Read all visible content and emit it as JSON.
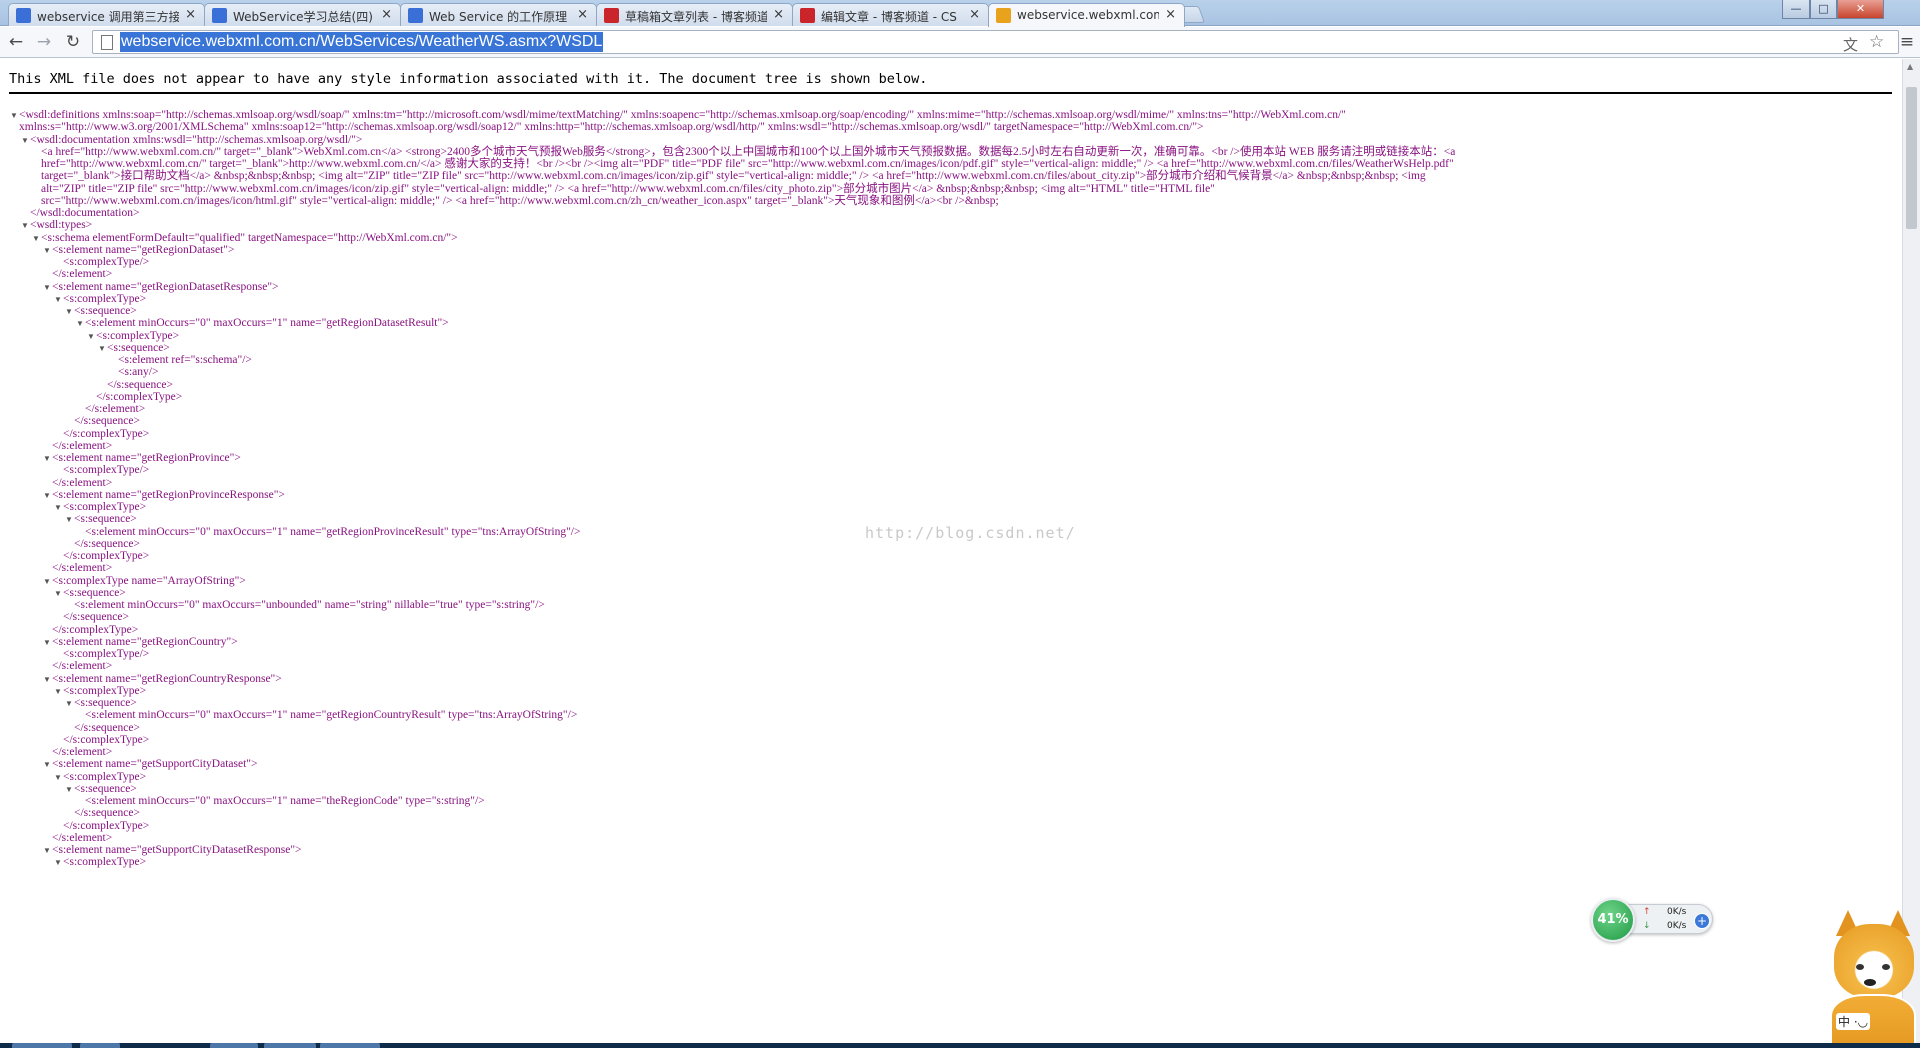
{
  "tabs": [
    {
      "title": "webservice 调用第三方接",
      "favicon_color": "#3a6fd8"
    },
    {
      "title": "WebService学习总结(四)",
      "favicon_color": "#3a6fd8"
    },
    {
      "title": "Web Service 的工作原理",
      "favicon_color": "#3a6fd8"
    },
    {
      "title": "草稿箱文章列表 - 博客频道",
      "favicon_color": "#c9252b"
    },
    {
      "title": "编辑文章 - 博客频道 - CS",
      "favicon_color": "#c9252b"
    },
    {
      "title": "webservice.webxml.com",
      "favicon_color": "#e8a21b"
    }
  ],
  "tab_close_glyph": "×",
  "window_controls": {
    "minimize": "—",
    "maximize": "□",
    "close": "✕"
  },
  "toolbar": {
    "back": "←",
    "forward": "→",
    "reload": "↻",
    "url": "webservice.webxml.com.cn/WebServices/WeatherWS.asmx?WSDL",
    "translate": "文",
    "star": "☆",
    "menu": "≡"
  },
  "notice": "This XML file does not appear to have any style information associated with it. The document tree is shown below.",
  "xml_lines": [
    {
      "i": 0,
      "t": "▼",
      "h": "<wsdl:definitions xmlns:soap=\"http://schemas.xmlsoap.org/wsdl/soap/\" xmlns:tm=\"http://microsoft.com/wsdl/mime/textMatching/\" xmlns:soapenc=\"http://schemas.xmlsoap.org/soap/encoding/\" xmlns:mime=\"http://schemas.xmlsoap.org/wsdl/mime/\" xmlns:tns=\"http://WebXml.com.cn/\""
    },
    {
      "i": 0,
      "t": "",
      "h": "xmlns:s=\"http://www.w3.org/2001/XMLSchema\" xmlns:soap12=\"http://schemas.xmlsoap.org/wsdl/soap12/\" xmlns:http=\"http://schemas.xmlsoap.org/wsdl/http/\" xmlns:wsdl=\"http://schemas.xmlsoap.org/wsdl/\" targetNamespace=\"http://WebXml.com.cn/\">"
    },
    {
      "i": 1,
      "t": "▼",
      "h": "<wsdl:documentation xmlns:wsdl=\"http://schemas.xmlsoap.org/wsdl/\">"
    },
    {
      "i": 2,
      "t": "",
      "h": "<a href=\"http://www.webxml.com.cn/\" target=\"_blank\">WebXml.com.cn</a> <strong>2400多个城市天气预报Web服务</strong>，包含2300个以上中国城市和100个以上国外城市天气预报数据。数据每2.5小时左右自动更新一次，准确可靠。<br />使用本站 WEB 服务请注明或链接本站：<a"
    },
    {
      "i": 2,
      "t": "",
      "h": "href=\"http://www.webxml.com.cn/\" target=\"_blank\">http://www.webxml.com.cn/</a> 感谢大家的支持！<br /><br /><img alt=\"PDF\" title=\"PDF file\" src=\"http://www.webxml.com.cn/images/icon/pdf.gif\" style=\"vertical-align: middle;\" /> <a href=\"http://www.webxml.com.cn/files/WeatherWsHelp.pdf\""
    },
    {
      "i": 2,
      "t": "",
      "h": "target=\"_blank\">接口帮助文档</a> &nbsp;&nbsp;&nbsp; <img alt=\"ZIP\" title=\"ZIP file\" src=\"http://www.webxml.com.cn/images/icon/zip.gif\" style=\"vertical-align: middle;\" /> <a href=\"http://www.webxml.com.cn/files/about_city.zip\">部分城市介绍和气候背景</a> &nbsp;&nbsp;&nbsp; <img"
    },
    {
      "i": 2,
      "t": "",
      "h": "alt=\"ZIP\" title=\"ZIP file\" src=\"http://www.webxml.com.cn/images/icon/zip.gif\" style=\"vertical-align: middle;\" /> <a href=\"http://www.webxml.com.cn/files/city_photo.zip\">部分城市图片</a> &nbsp;&nbsp;&nbsp; <img alt=\"HTML\" title=\"HTML file\""
    },
    {
      "i": 2,
      "t": "",
      "h": "src=\"http://www.webxml.com.cn/images/icon/html.gif\" style=\"vertical-align: middle;\" /> <a href=\"http://www.webxml.com.cn/zh_cn/weather_icon.aspx\" target=\"_blank\">天气现象和图例</a><br />&nbsp;"
    },
    {
      "i": 1,
      "t": "",
      "h": "</wsdl:documentation>"
    },
    {
      "i": 1,
      "t": "▼",
      "h": "<wsdl:types>"
    },
    {
      "i": 2,
      "t": "▼",
      "h": "<s:schema elementFormDefault=\"qualified\" targetNamespace=\"http://WebXml.com.cn/\">"
    },
    {
      "i": 3,
      "t": "▼",
      "h": "<s:element name=\"getRegionDataset\">"
    },
    {
      "i": 4,
      "t": "",
      "h": "<s:complexType/>"
    },
    {
      "i": 3,
      "t": "",
      "h": "</s:element>"
    },
    {
      "i": 3,
      "t": "▼",
      "h": "<s:element name=\"getRegionDatasetResponse\">"
    },
    {
      "i": 4,
      "t": "▼",
      "h": "<s:complexType>"
    },
    {
      "i": 5,
      "t": "▼",
      "h": "<s:sequence>"
    },
    {
      "i": 6,
      "t": "▼",
      "h": "<s:element minOccurs=\"0\" maxOccurs=\"1\" name=\"getRegionDatasetResult\">"
    },
    {
      "i": 7,
      "t": "▼",
      "h": "<s:complexType>"
    },
    {
      "i": 8,
      "t": "▼",
      "h": "<s:sequence>"
    },
    {
      "i": 9,
      "t": "",
      "h": "<s:element ref=\"s:schema\"/>"
    },
    {
      "i": 9,
      "t": "",
      "h": "<s:any/>"
    },
    {
      "i": 8,
      "t": "",
      "h": "</s:sequence>"
    },
    {
      "i": 7,
      "t": "",
      "h": "</s:complexType>"
    },
    {
      "i": 6,
      "t": "",
      "h": "</s:element>"
    },
    {
      "i": 5,
      "t": "",
      "h": "</s:sequence>"
    },
    {
      "i": 4,
      "t": "",
      "h": "</s:complexType>"
    },
    {
      "i": 3,
      "t": "",
      "h": "</s:element>"
    },
    {
      "i": 3,
      "t": "▼",
      "h": "<s:element name=\"getRegionProvince\">"
    },
    {
      "i": 4,
      "t": "",
      "h": "<s:complexType/>"
    },
    {
      "i": 3,
      "t": "",
      "h": "</s:element>"
    },
    {
      "i": 3,
      "t": "▼",
      "h": "<s:element name=\"getRegionProvinceResponse\">"
    },
    {
      "i": 4,
      "t": "▼",
      "h": "<s:complexType>"
    },
    {
      "i": 5,
      "t": "▼",
      "h": "<s:sequence>"
    },
    {
      "i": 6,
      "t": "",
      "h": "<s:element minOccurs=\"0\" maxOccurs=\"1\" name=\"getRegionProvinceResult\" type=\"tns:ArrayOfString\"/>"
    },
    {
      "i": 5,
      "t": "",
      "h": "</s:sequence>"
    },
    {
      "i": 4,
      "t": "",
      "h": "</s:complexType>"
    },
    {
      "i": 3,
      "t": "",
      "h": "</s:element>"
    },
    {
      "i": 3,
      "t": "▼",
      "h": "<s:complexType name=\"ArrayOfString\">"
    },
    {
      "i": 4,
      "t": "▼",
      "h": "<s:sequence>"
    },
    {
      "i": 5,
      "t": "",
      "h": "<s:element minOccurs=\"0\" maxOccurs=\"unbounded\" name=\"string\" nillable=\"true\" type=\"s:string\"/>"
    },
    {
      "i": 4,
      "t": "",
      "h": "</s:sequence>"
    },
    {
      "i": 3,
      "t": "",
      "h": "</s:complexType>"
    },
    {
      "i": 3,
      "t": "▼",
      "h": "<s:element name=\"getRegionCountry\">"
    },
    {
      "i": 4,
      "t": "",
      "h": "<s:complexType/>"
    },
    {
      "i": 3,
      "t": "",
      "h": "</s:element>"
    },
    {
      "i": 3,
      "t": "▼",
      "h": "<s:element name=\"getRegionCountryResponse\">"
    },
    {
      "i": 4,
      "t": "▼",
      "h": "<s:complexType>"
    },
    {
      "i": 5,
      "t": "▼",
      "h": "<s:sequence>"
    },
    {
      "i": 6,
      "t": "",
      "h": "<s:element minOccurs=\"0\" maxOccurs=\"1\" name=\"getRegionCountryResult\" type=\"tns:ArrayOfString\"/>"
    },
    {
      "i": 5,
      "t": "",
      "h": "</s:sequence>"
    },
    {
      "i": 4,
      "t": "",
      "h": "</s:complexType>"
    },
    {
      "i": 3,
      "t": "",
      "h": "</s:element>"
    },
    {
      "i": 3,
      "t": "▼",
      "h": "<s:element name=\"getSupportCityDataset\">"
    },
    {
      "i": 4,
      "t": "▼",
      "h": "<s:complexType>"
    },
    {
      "i": 5,
      "t": "▼",
      "h": "<s:sequence>"
    },
    {
      "i": 6,
      "t": "",
      "h": "<s:element minOccurs=\"0\" maxOccurs=\"1\" name=\"theRegionCode\" type=\"s:string\"/>"
    },
    {
      "i": 5,
      "t": "",
      "h": "</s:sequence>"
    },
    {
      "i": 4,
      "t": "",
      "h": "</s:complexType>"
    },
    {
      "i": 3,
      "t": "",
      "h": "</s:element>"
    },
    {
      "i": 3,
      "t": "▼",
      "h": "<s:element name=\"getSupportCityDatasetResponse\">"
    },
    {
      "i": 4,
      "t": "▼",
      "h": "<s:complexType>"
    }
  ],
  "watermark": "http://blog.csdn.net/",
  "net_widget": {
    "percent": "41%",
    "up_arrow": "↑",
    "down_arrow": "↓",
    "upload": "0K/s",
    "download": "0K/s",
    "plus": "+"
  },
  "mascot_label": "中 ·◡"
}
